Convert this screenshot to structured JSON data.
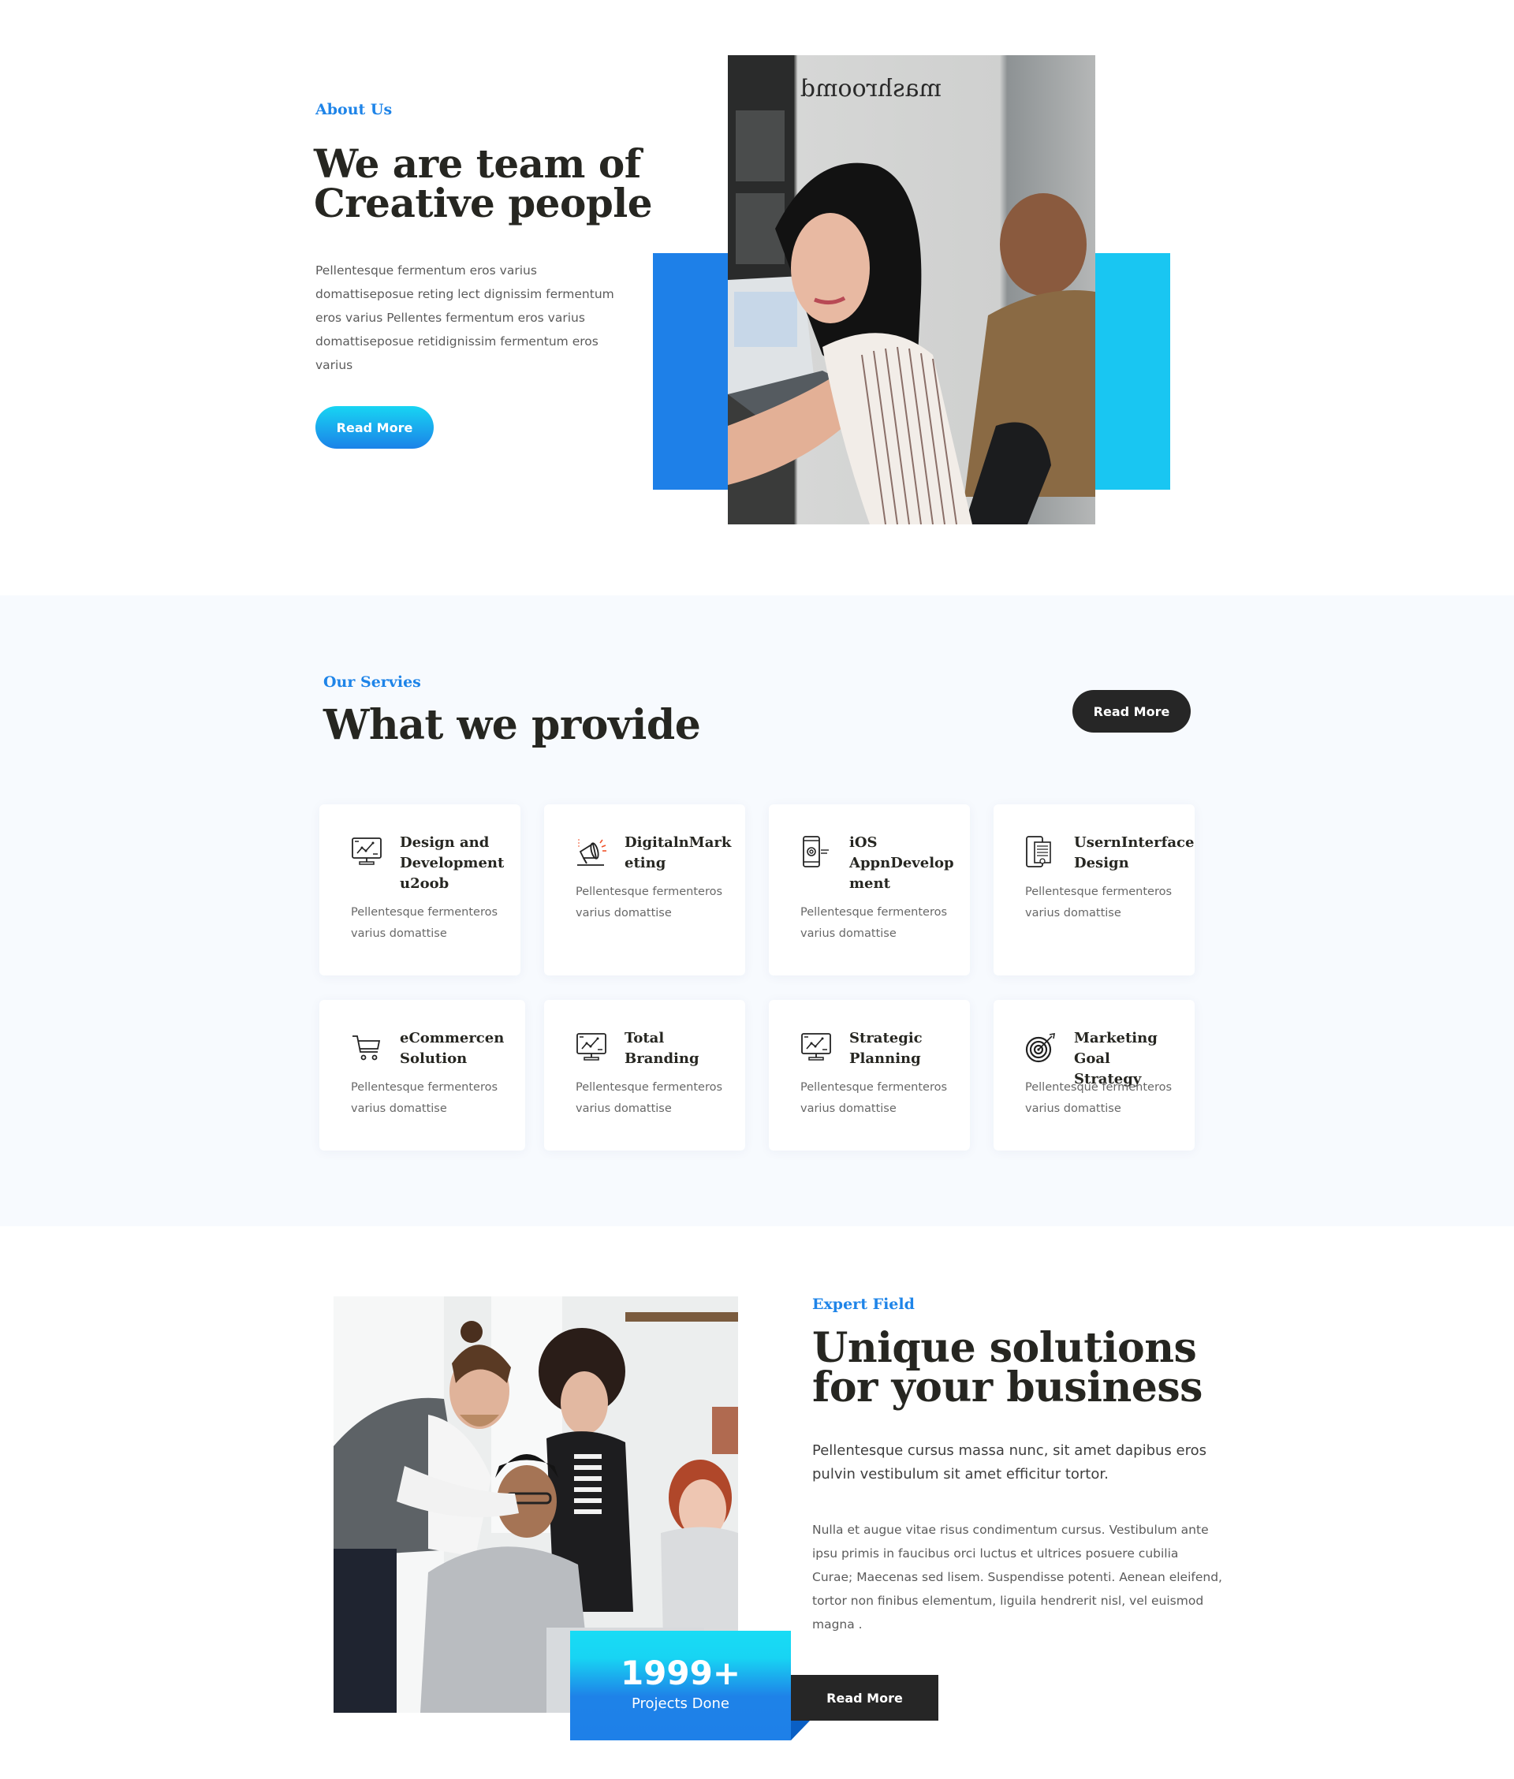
{
  "about": {
    "eyebrow": "About Us",
    "title": "We are team of Creative people",
    "text": "Pellentesque fermentum eros varius domattiseposue reting lect dignissim fermentum eros varius Pellentes fermentum eros varius domattiseposue retidignissim fermentum eros varius",
    "button_label": "Read More",
    "image_alt": "Two coworkers sitting at desk in office, woman smiling at camera"
  },
  "services": {
    "eyebrow": "Our Servies",
    "title": "What we provide",
    "button_label": "Read More",
    "items": [
      {
        "icon": "monitor-chart-icon",
        "title": "Design and Development u2oob",
        "text": "Pellentesque fermenteros varius domattise"
      },
      {
        "icon": "megaphone-icon",
        "title": "DigitalnMark eting",
        "text": "Pellentesque fermenteros varius domattise"
      },
      {
        "icon": "mobile-gear-icon",
        "title": "iOS AppnDevelop ment",
        "text": "Pellentesque fermenteros varius domattise"
      },
      {
        "icon": "mobile-ui-icon",
        "title": "UsernInterface Design",
        "text": "Pellentesque fermenteros varius domattise"
      },
      {
        "icon": "shopping-cart-icon",
        "title": "eCommercen Solution",
        "text": "Pellentesque fermenteros varius domattise"
      },
      {
        "icon": "monitor-chart-icon",
        "title": "Total Branding",
        "text": "Pellentesque fermenteros varius domattise"
      },
      {
        "icon": "monitor-chart-icon",
        "title": "Strategic Planning",
        "text": "Pellentesque fermenteros varius domattise"
      },
      {
        "icon": "target-icon",
        "title": "Marketing Goal Strategy",
        "text": "Pellentesque fermenteros varius domattise"
      }
    ]
  },
  "expert": {
    "eyebrow": "Expert Field",
    "title": "Unique solutions for your business",
    "lead": "Pellentesque cursus massa nunc, sit amet dapibus eros pulvin vestibulum sit amet efficitur tortor.",
    "text": "Nulla et augue vitae risus condimentum cursus. Vestibulum ante ipsu primis in faucibus orci luctus et ultrices posuere cubilia Curae; Maecenas sed lisem. Suspendisse potenti. Aenean eleifend, tortor non finibus elementum, liguila hendrerit nisl, vel euismod magna .",
    "stat_number": "1999+",
    "stat_label": "Projects Done",
    "button_label": "Read More",
    "image_alt": "Group of smiling coworkers gathered around a laptop"
  },
  "colors": {
    "accent_blue": "#1e84e8",
    "accent_cyan": "#18d5f3",
    "dark": "#262626",
    "section_bg": "#f7fafe"
  }
}
